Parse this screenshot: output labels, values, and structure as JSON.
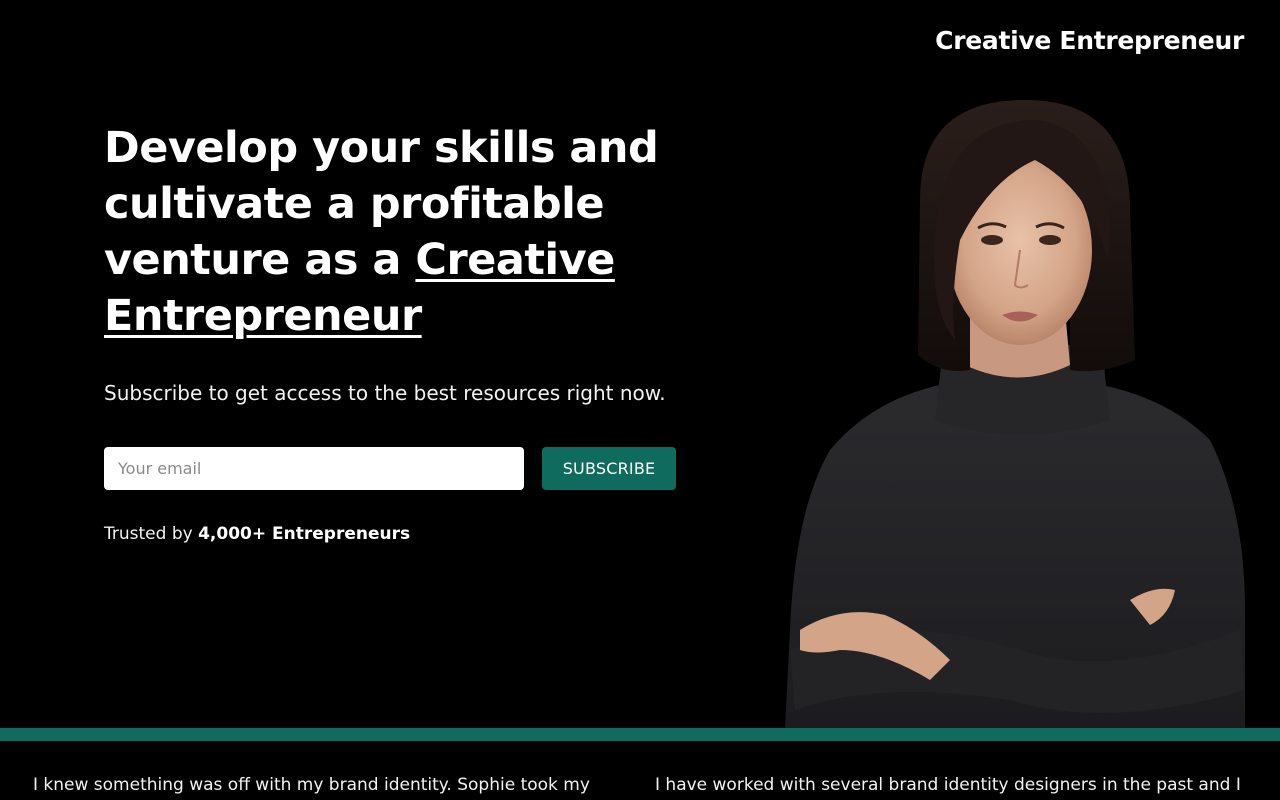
{
  "header": {
    "brand": "Creative Entrepreneur"
  },
  "hero": {
    "title_part1": "Develop your skills and cultivate a profitable venture as a",
    "title_highlight": "Creative Entrepreneur",
    "subtitle": "Subscribe to get access to the best resources right now.",
    "email_placeholder": "Your email",
    "subscribe_label": "SUBSCRIBE",
    "trusted_prefix": "Trusted by",
    "trusted_count": "4,000+ Entrepreneurs"
  },
  "testimonials": [
    {
      "text": "I knew something was off with my brand identity. Sophie took my"
    },
    {
      "text": "I have worked with several brand identity designers in the past and I"
    }
  ],
  "colors": {
    "accent": "#0e6b5e",
    "background": "#000000",
    "text": "#ffffff"
  }
}
